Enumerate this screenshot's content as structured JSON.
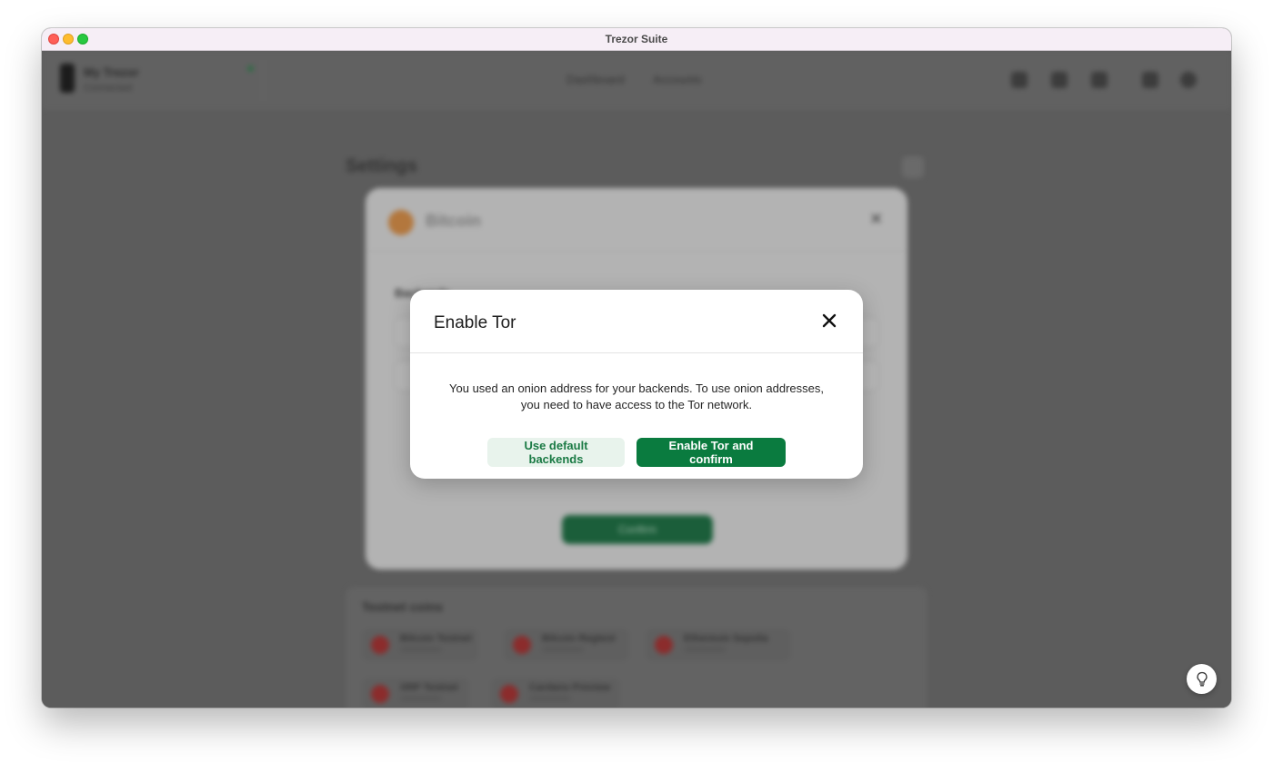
{
  "window": {
    "title": "Trezor Suite"
  },
  "background": {
    "device_name": "My Trezor",
    "device_status": "Connected",
    "nav": [
      "Dashboard",
      "Accounts"
    ],
    "page_title": "Settings",
    "coin_modal": {
      "title": "Bitcoin",
      "section_label": "Backends",
      "confirm_label": "Confirm"
    },
    "coins_panel": {
      "title": "Testnet coins",
      "coins": [
        "Bitcoin Testnet",
        "Bitcoin Regtest",
        "Ethereum Sepolia",
        "XRP Testnet",
        "Cardano Preview"
      ]
    }
  },
  "dialog": {
    "title": "Enable Tor",
    "message_line1": "You used an onion address for your backends. To use onion addresses,",
    "message_line2": "you need to have access to the Tor network.",
    "secondary_button": "Use default backends",
    "primary_button": "Enable Tor and confirm"
  },
  "colors": {
    "accent": "#0a7b3f",
    "secondary_bg": "#e8f3ec",
    "overlay": "#5c5c5c"
  },
  "icons": {
    "close": "close-icon",
    "hint": "lightbulb-icon"
  }
}
